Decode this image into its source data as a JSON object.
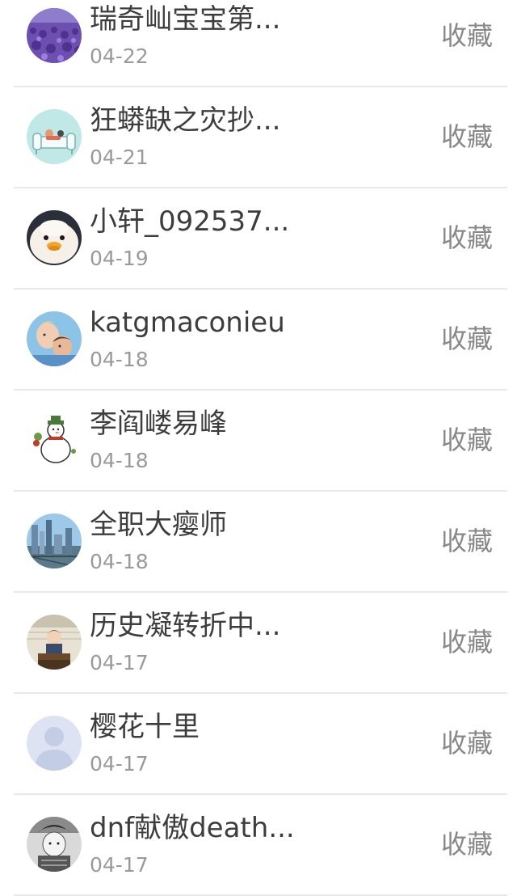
{
  "colors": {
    "name_text": "#3d3d3d",
    "date_text": "#9a9a9a",
    "action_text": "#888888",
    "divider": "#e9e9e9"
  },
  "items": [
    {
      "name": "瑞奇屾宝宝第...",
      "date": "04-22",
      "action": "收藏",
      "avatar": "lavender-field-avatar"
    },
    {
      "name": "狂蟒缺之灾抄...",
      "date": "04-21",
      "action": "收藏",
      "avatar": "sofa-illustration-avatar"
    },
    {
      "name": "小轩_092537...",
      "date": "04-19",
      "action": "收藏",
      "avatar": "duckling-avatar"
    },
    {
      "name": "katgmaconieu",
      "date": "04-18",
      "action": "收藏",
      "avatar": "couple-photo-avatar"
    },
    {
      "name": "李阎嵝易峰",
      "date": "04-18",
      "action": "收藏",
      "avatar": "snowman-avatar"
    },
    {
      "name": "全职大瘿师",
      "date": "04-18",
      "action": "收藏",
      "avatar": "city-skyline-avatar"
    },
    {
      "name": "历史凝转折中...",
      "date": "04-17",
      "action": "收藏",
      "avatar": "anime-character-avatar"
    },
    {
      "name": "樱花十里",
      "date": "04-17",
      "action": "收藏",
      "avatar": "default-person-avatar"
    },
    {
      "name": "dnf献傲death...",
      "date": "04-17",
      "action": "收藏",
      "avatar": "manga-sketch-avatar"
    }
  ]
}
